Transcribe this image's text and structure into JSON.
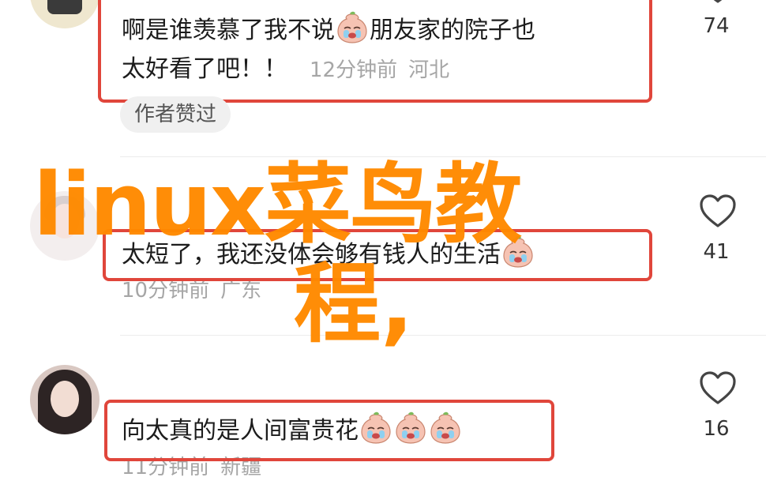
{
  "comments": [
    {
      "line1": "啊是谁羡慕了我不说",
      "line1_after": "朋友家的院子也",
      "line2": "太好看了吧！！",
      "time": "12分钟前",
      "location": "河北",
      "badge": "作者赞过",
      "likes": "74"
    },
    {
      "text": "太短了，我还没体会够有钱人的生活",
      "time": "10分钟前",
      "location": "广东",
      "likes": "41"
    },
    {
      "text": "向太真的是人间富贵花",
      "time": "11分钟前",
      "location": "新疆",
      "likes": "16"
    }
  ],
  "watermark": {
    "line1": "linux菜鸟教",
    "line2": "程,"
  },
  "colors": {
    "highlight_box": "#e0463b",
    "watermark": "#ff8a00",
    "meta_text": "#a6a6a6"
  },
  "icons": [
    "heart-icon",
    "crying-peach-emoji"
  ]
}
